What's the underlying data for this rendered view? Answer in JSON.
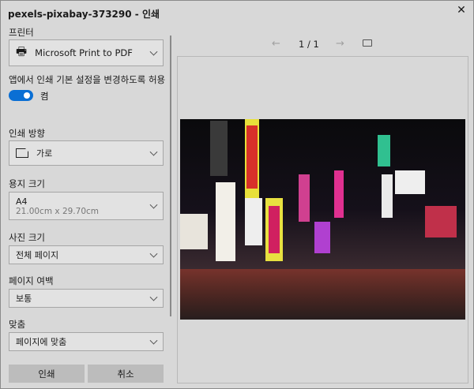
{
  "window": {
    "title": "pexels-pixabay-373290 - 인쇄",
    "close_icon": "close-icon"
  },
  "printer": {
    "label": "프린터",
    "value": "Microsoft Print to PDF",
    "icon": "printer-icon"
  },
  "app_settings": {
    "label": "앱에서 인쇄 기본 설정을 변경하도록 허용",
    "toggle_state": "켬",
    "on": true,
    "accent": "#0a6fd4"
  },
  "orientation": {
    "label": "인쇄 방향",
    "value": "가로",
    "icon": "page-icon"
  },
  "paper_size": {
    "label": "용지 크기",
    "value": "A4",
    "sub": "21.00cm x 29.70cm"
  },
  "photo_size": {
    "label": "사진 크기",
    "value": "전체 페이지"
  },
  "margins": {
    "label": "페이지 여백",
    "value": "보통"
  },
  "fit": {
    "label": "맞춤",
    "value": "페이지에 맞춤"
  },
  "buttons": {
    "print": "인쇄",
    "cancel": "취소"
  },
  "preview": {
    "page_indicator": "1 / 1",
    "prev_icon": "arrow-left-icon",
    "next_icon": "arrow-right-icon",
    "fit_icon": "fit-page-icon"
  }
}
